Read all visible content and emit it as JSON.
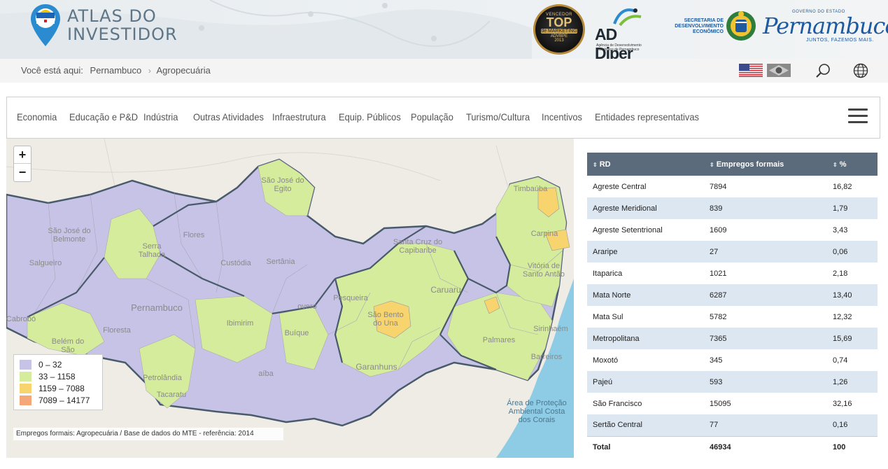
{
  "header": {
    "logo_line1": "ATLAS DO",
    "logo_line2": "INVESTIDOR",
    "badge": {
      "line1": "VENCEDOR",
      "line2": "TOP",
      "line3": "de MARKETING",
      "line4": "ADVBPE",
      "line5": "2013"
    },
    "addiper": {
      "name": "AD Diper",
      "sub": "Agência de Desenvolvimento Econômico de Pernambuco"
    },
    "gov": {
      "secretaria": "SECRETARIA DE DESENVOLVIMENTO ECONÔMICO",
      "small": "GOVERNO DO ESTADO",
      "name": "Pernambuco",
      "tagline": "JUNTOS, FAZEMOS MAIS."
    }
  },
  "breadcrumb": {
    "prefix": "Você está aqui:",
    "items": [
      "Pernambuco",
      "Agropecuária"
    ]
  },
  "nav": {
    "items": [
      "Economia",
      "Educação e P&D",
      "Indústria",
      "Outras Atividades",
      "Infraestrutura",
      "Equip. Públicos",
      "População",
      "Turismo/Cultura",
      "Incentivos",
      "Entidades representativas"
    ]
  },
  "map": {
    "zoom_in": "+",
    "zoom_out": "−",
    "legend": [
      {
        "label": "0 – 32",
        "color": "#c7c3e6"
      },
      {
        "label": "33 – 1158",
        "color": "#d6ec9d"
      },
      {
        "label": "1159 – 7088",
        "color": "#f7d46e"
      },
      {
        "label": "7089 – 14177",
        "color": "#f5a777"
      }
    ],
    "caption": "Empregos formais: Agropecuária / Base de dados do MTE - referência: 2014",
    "labels": {
      "sao_jose_egito": "São José do Egito",
      "sao_jose_belmonte": "São José do Belmonte",
      "serra_talhada": "Serra Talhada",
      "flores": "Flores",
      "salgueiro": "Salgueiro",
      "custodia": "Custódia",
      "sertania": "Sertânia",
      "pernambuco": "Pernambuco",
      "cabrobo": "Cabrobó",
      "floresta": "Floresta",
      "belem": "Belém do São",
      "ibimirim": "Ibimirim",
      "buique": "Buíque",
      "petrolandia": "Petrolândia",
      "tacaratu": "Tacaratu",
      "aiba": "aíba",
      "pesqueira": "Pesqueira",
      "sao_bento": "São Bento do Una",
      "caruaru": "Caruaru",
      "garanhuns": "Garanhuns",
      "palmares": "Palmares",
      "santa_cruz": "Santa Cruz do Capibaribe",
      "timbauba": "Timbaúba",
      "carpina": "Carpina",
      "vitoria": "Vitória de Santo Antão",
      "sirinhaem": "Sirinhaém",
      "barreiros": "Barreiros",
      "area_protecao": "Área de Proteção Ambiental Costa dos Corais",
      "overo": "overo"
    }
  },
  "table": {
    "headers": [
      "RD",
      "Empregos formais",
      "%"
    ],
    "rows": [
      [
        "Agreste Central",
        "7894",
        "16,82"
      ],
      [
        "Agreste Meridional",
        "839",
        "1,79"
      ],
      [
        "Agreste Setentrional",
        "1609",
        "3,43"
      ],
      [
        "Araripe",
        "27",
        "0,06"
      ],
      [
        "Itaparica",
        "1021",
        "2,18"
      ],
      [
        "Mata Norte",
        "6287",
        "13,40"
      ],
      [
        "Mata Sul",
        "5782",
        "12,32"
      ],
      [
        "Metropolitana",
        "7365",
        "15,69"
      ],
      [
        "Moxotó",
        "345",
        "0,74"
      ],
      [
        "Pajeú",
        "593",
        "1,26"
      ],
      [
        "São Francisco",
        "15095",
        "32,16"
      ],
      [
        "Sertão Central",
        "77",
        "0,16"
      ]
    ],
    "total": [
      "Total",
      "46934",
      "100"
    ]
  }
}
